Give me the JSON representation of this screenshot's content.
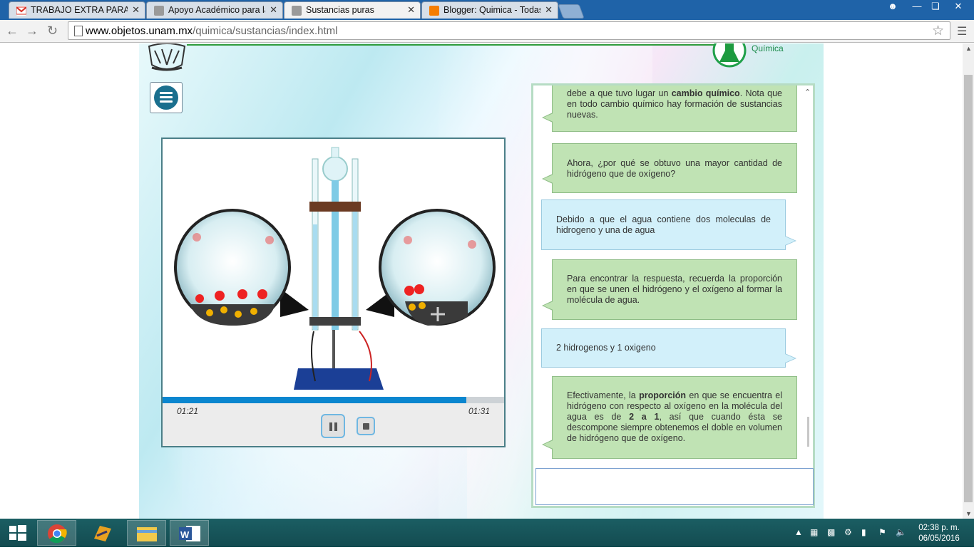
{
  "browser": {
    "tabs": [
      {
        "title": "TRABAJO EXTRA PARA IN",
        "favicon": "gmail-icon",
        "color": "#d93025"
      },
      {
        "title": "Apoyo Académico para la",
        "favicon": "unam-icon",
        "color": "#7a7a7a"
      },
      {
        "title": "Sustancias puras",
        "favicon": "unam-icon",
        "color": "#7a7a7a",
        "active": true
      },
      {
        "title": "Blogger: Quimica - Todas",
        "favicon": "blogger-icon",
        "color": "#f57d00"
      }
    ],
    "close_glyph": "✕",
    "url_host": "www.objetos.unam.mx",
    "url_path": "/quimica/sustancias/index.html"
  },
  "header": {
    "brand_label": "Química",
    "accent_color": "#2e9b3b"
  },
  "video": {
    "elapsed": "01:21",
    "duration": "01:31",
    "progress": 0.89,
    "state": "playing"
  },
  "chat": {
    "messages": [
      {
        "from": "tutor",
        "html": "debe a que tuvo lugar un <b>cambio químico</b>. Nota que en todo cambio químico hay formación de sustancias nuevas."
      },
      {
        "from": "tutor",
        "html": "Ahora, ¿por qué se obtuvo una mayor cantidad de hidrógeno que de oxígeno?"
      },
      {
        "from": "student",
        "html": "Debido a que el agua contiene dos moleculas de hidrogeno y una de agua"
      },
      {
        "from": "tutor",
        "html": "Para encontrar la respuesta, recuerda la proporción en que se unen el hidrógeno y el oxígeno al formar la molécula de agua."
      },
      {
        "from": "student",
        "html": "2 hidrogenos y 1 oxigeno"
      },
      {
        "from": "tutor",
        "html": "Efectivamente, la <b>proporción</b> en que se encuentra el hidrógeno con respecto al oxígeno en la molécula del agua es de <b>2 a 1</b>, así que cuando ésta se descompone siempre obtenemos el doble en volumen de hidrógeno que de oxígeno."
      }
    ],
    "answer_value": ""
  },
  "taskbar": {
    "time": "02:38 p. m.",
    "date": "06/05/2016"
  }
}
